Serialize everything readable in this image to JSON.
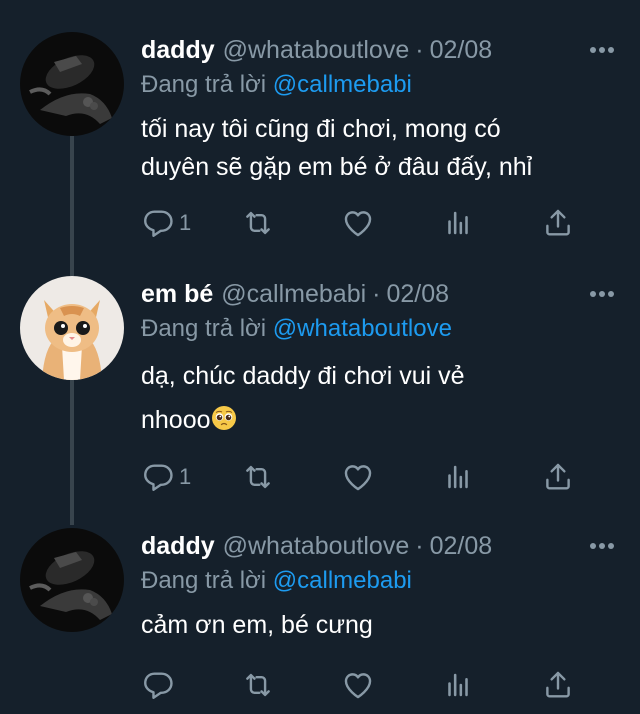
{
  "tweets": [
    {
      "name": "daddy",
      "handle": "@whataboutlove",
      "date": "02/08",
      "reply_prefix": "Đang trả lời",
      "reply_mention": "@callmebabi",
      "text_line1": "tối nay tôi cũng đi chơi, mong có",
      "text_line2": "duyên sẽ gặp em bé ở đâu đấy, nhỉ",
      "reply_count": "1",
      "avatar": "dark-hands-photo"
    },
    {
      "name": "em bé",
      "handle": "@callmebabi",
      "date": "02/08",
      "reply_prefix": "Đang trả lời",
      "reply_mention": "@whataboutlove",
      "text_line1": "dạ, chúc daddy đi chơi vui vẻ",
      "text_line2": "nhooo",
      "reply_count": "1",
      "avatar": "kitten-photo",
      "emoji": "pleading-face-emoji"
    },
    {
      "name": "daddy",
      "handle": "@whataboutlove",
      "date": "02/08",
      "reply_prefix": "Đang trả lời",
      "reply_mention": "@callmebabi",
      "text_line1": "cảm ơn em, bé cưng",
      "reply_count": "",
      "avatar": "dark-hands-photo"
    }
  ],
  "separator": "·",
  "icons": [
    "reply-icon",
    "retweet-icon",
    "like-icon",
    "analytics-icon",
    "share-icon",
    "more-icon"
  ],
  "colors": {
    "background": "#15202b",
    "secondary_text": "#8899a6",
    "mention": "#1d9bf0",
    "thread_line": "#38444d"
  }
}
